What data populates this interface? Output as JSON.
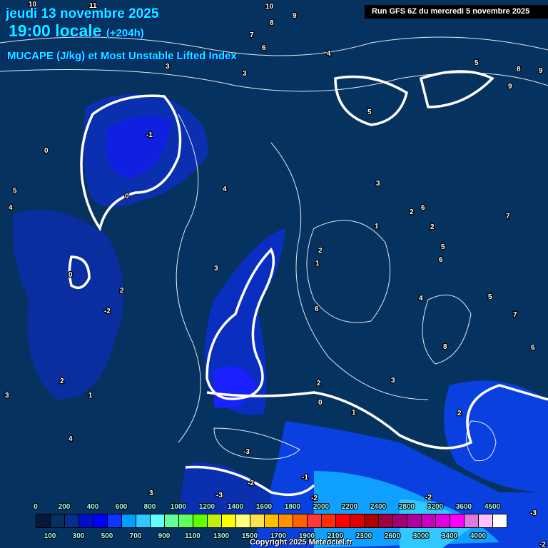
{
  "header": {
    "date": "jeudi 13 novembre 2025",
    "time": "19:00 locale",
    "lead": "(+204h)",
    "parameter": "MUCAPE (J/kg) et Most Unstable Lifted Index",
    "run": "Run GFS 6Z du mercredi 5 novembre 2025"
  },
  "legend": {
    "top_labels": [
      "0",
      "200",
      "400",
      "600",
      "800",
      "1000",
      "1200",
      "1400",
      "1600",
      "1800",
      "2000",
      "2200",
      "2400",
      "2800",
      "3200",
      "3600",
      "4500"
    ],
    "bottom_labels": [
      "100",
      "300",
      "500",
      "700",
      "900",
      "1100",
      "1300",
      "1500",
      "1700",
      "1900",
      "2100",
      "2300",
      "2600",
      "3000",
      "3400",
      "4000"
    ],
    "colors": [
      "#0a1838",
      "#06305e",
      "#033090",
      "#0010c8",
      "#0000ff",
      "#0838ff",
      "#00a0ff",
      "#30c8ff",
      "#60ffff",
      "#60ff9a",
      "#60ff60",
      "#60ff00",
      "#c0f010",
      "#ffff00",
      "#ffff80",
      "#ffe050",
      "#ffc000",
      "#ff9000",
      "#ff6000",
      "#ff3838",
      "#ff3000",
      "#ff0000",
      "#e00000",
      "#b00000",
      "#a00040",
      "#a00070",
      "#b000a0",
      "#c800c0",
      "#e000e0",
      "#ff00ff",
      "#e078e0",
      "#ffc0ff",
      "#ffffff"
    ]
  },
  "contour_labels": [
    "10",
    "11",
    "10",
    "9",
    "8",
    "7",
    "6",
    "4",
    "3",
    "3",
    "5",
    "9",
    "8",
    "9",
    "5",
    "0",
    "-1",
    "0",
    "5",
    "4",
    "4",
    "3",
    "0",
    "-2",
    "2",
    "2",
    "1",
    "6",
    "6",
    "5",
    "6",
    "2",
    "2",
    "1",
    "3",
    "4",
    "7",
    "8",
    "6",
    "7",
    "5",
    "3",
    "2",
    "0",
    "1",
    "-2",
    "-2",
    "-3",
    "-1",
    "-2",
    "-3",
    "-3",
    "-2",
    "2",
    "1",
    "3",
    "2",
    "4",
    "3"
  ],
  "copyright": "Copyright 2025 Meteociel.fr"
}
